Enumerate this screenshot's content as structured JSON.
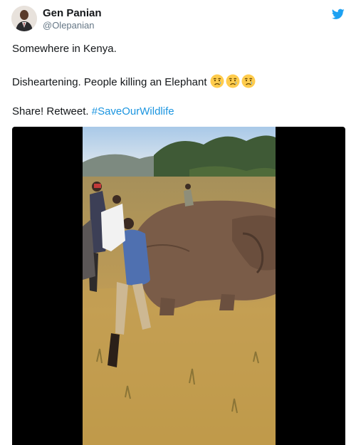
{
  "user": {
    "display_name": "Gen Panian",
    "handle": "@Olepanian"
  },
  "tweet": {
    "line1": "Somewhere in Kenya.",
    "line2": "Disheartening. People killing an Elephant",
    "line3_prefix": "Share! Retweet.",
    "hashtag": "#SaveOurWildlife",
    "emojis": [
      "crying-face",
      "crying-face",
      "crying-face"
    ]
  },
  "icons": {
    "brand": "twitter-bird-icon"
  },
  "colors": {
    "twitter_blue": "#1da1f2",
    "hashtag": "#1b95e0",
    "media_background": "#000000",
    "primary_text": "#14171a",
    "secondary_text": "#657786"
  }
}
